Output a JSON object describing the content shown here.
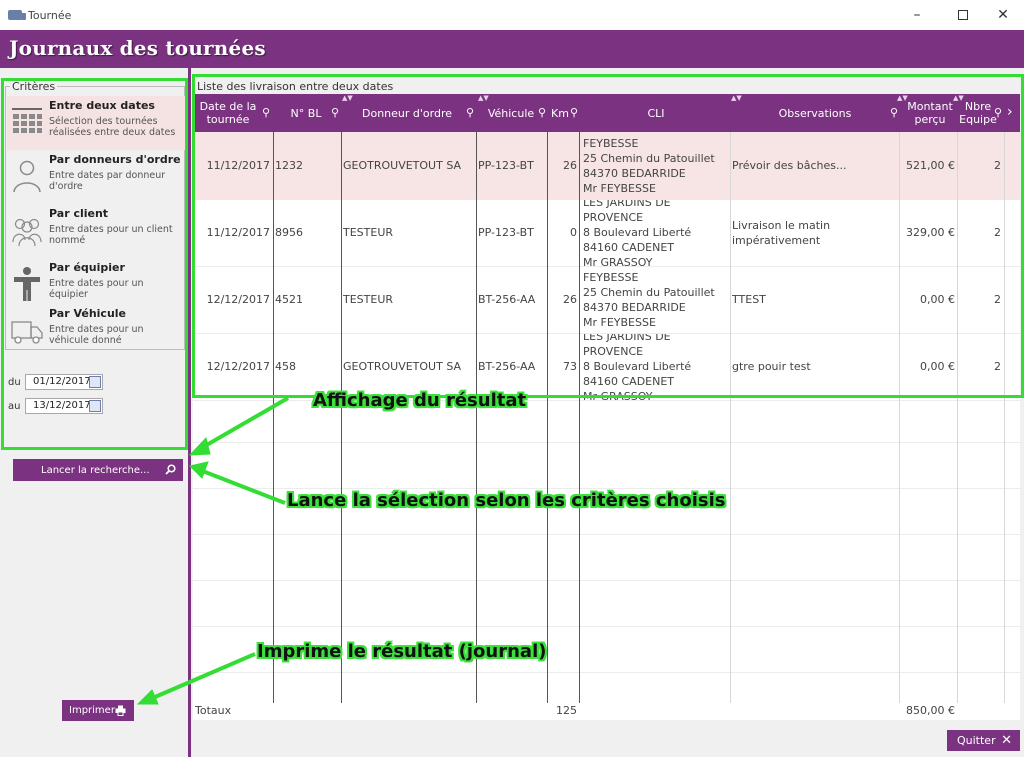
{
  "window": {
    "title": "Tournée"
  },
  "banner": {
    "title": "Journaux des tournées"
  },
  "criteria": {
    "legend": "Critères",
    "items": [
      {
        "title": "Entre deux dates",
        "desc": "Sélection des tournées réalisées entre deux dates",
        "icon": "calendar-icon"
      },
      {
        "title": "Par donneurs d'ordre",
        "desc": "Entre dates par donneur d'ordre",
        "icon": "user-icon"
      },
      {
        "title": "Par client",
        "desc": "Entre dates pour un client nommé",
        "icon": "users-group-icon"
      },
      {
        "title": "Par équipier",
        "desc": "Entre dates pour un équipier",
        "icon": "person-icon"
      },
      {
        "title": "Par Véhicule",
        "desc": "Entre dates pour un véhicule donné",
        "icon": "truck-icon"
      }
    ],
    "date_from_label": "du",
    "date_from": "01/12/2017",
    "date_to_label": "au",
    "date_to": "13/12/2017"
  },
  "buttons": {
    "search": "Lancer la recherche...",
    "print": "Imprimer",
    "quit": "Quitter"
  },
  "list": {
    "caption": "Liste des livraison entre deux dates",
    "columns": [
      "Date de la tournée",
      "N° BL",
      "Donneur d'ordre",
      "Véhicule",
      "Km",
      "CLI",
      "Observations",
      "Montant perçu",
      "Nbre Equipe"
    ],
    "rows": [
      {
        "date": "11/12/2017",
        "bl": "1232",
        "donneur": "GEOTROUVETOUT SA",
        "vehicule": "PP-123-BT",
        "km": "26",
        "cli": "FEYBESSE\n25 Chemin du Patouillet\n84370 BEDARRIDE\nMr FEYBESSE",
        "obs": "Prévoir des bâches...",
        "montant": "521,00 €",
        "equipe": "2"
      },
      {
        "date": "11/12/2017",
        "bl": "8956",
        "donneur": "TESTEUR",
        "vehicule": "PP-123-BT",
        "km": "0",
        "cli": "LES JARDINS DE PROVENCE\n8 Boulevard Liberté\n84160 CADENET\nMr GRASSOY",
        "obs": "Livraison le matin\nimpérativement",
        "montant": "329,00 €",
        "equipe": "2"
      },
      {
        "date": "12/12/2017",
        "bl": "4521",
        "donneur": "TESTEUR",
        "vehicule": "BT-256-AA",
        "km": "26",
        "cli": "FEYBESSE\n25 Chemin du Patouillet\n84370 BEDARRIDE\nMr FEYBESSE",
        "obs": "TTEST",
        "montant": "0,00 €",
        "equipe": "2"
      },
      {
        "date": "12/12/2017",
        "bl": "458",
        "donneur": "GEOTROUVETOUT SA",
        "vehicule": "BT-256-AA",
        "km": "73",
        "cli": "LES JARDINS DE PROVENCE\n8 Boulevard Liberté\n84160 CADENET\nMr GRASSOY",
        "obs": "gtre pouir test",
        "montant": "0,00 €",
        "equipe": "2"
      }
    ],
    "totals": {
      "label": "Totaux",
      "km": "125",
      "montant": "850,00 €"
    }
  },
  "annotations": {
    "result": "Affichage du résultat",
    "search": "Lance la sélection selon les critères choisis",
    "print": "Imprime le résultat (journal)",
    "color": "#33dd33"
  },
  "theme": {
    "primary": "#7b3381",
    "selected_row": "#f7e5e5"
  }
}
